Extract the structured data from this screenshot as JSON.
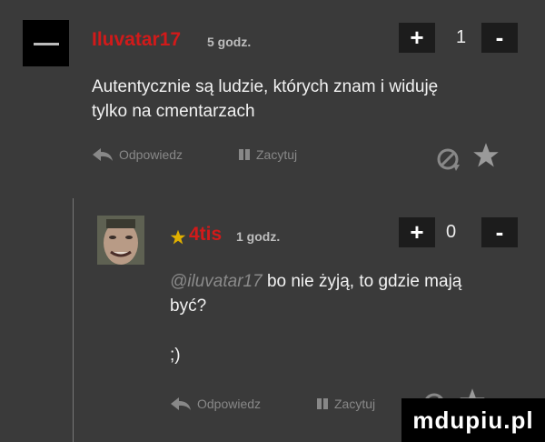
{
  "comments": [
    {
      "username": "Iluvatar17",
      "time": "5 godz.",
      "plus": "+",
      "score": "1",
      "minus": "-",
      "text_lines": [
        "Autentycznie są ludzie, których znam i widuję",
        "tylko na cmentarzach"
      ],
      "reply": "Odpowiedz",
      "quote": "Zacytuj"
    },
    {
      "username": "4tis",
      "time": "1 godz.",
      "plus": "+",
      "score": "0",
      "minus": "-",
      "mention": "@iluvatar17",
      "text_line1": "bo nie żyją, to gdzie mają",
      "text_line2": "być?",
      "text_line3": ";)",
      "reply": "Odpowiedz",
      "quote": "Zacytuj"
    }
  ],
  "watermark": "mdupiu.pl",
  "colors": {
    "username": "#d11a1a",
    "background": "#3a3a3a"
  }
}
